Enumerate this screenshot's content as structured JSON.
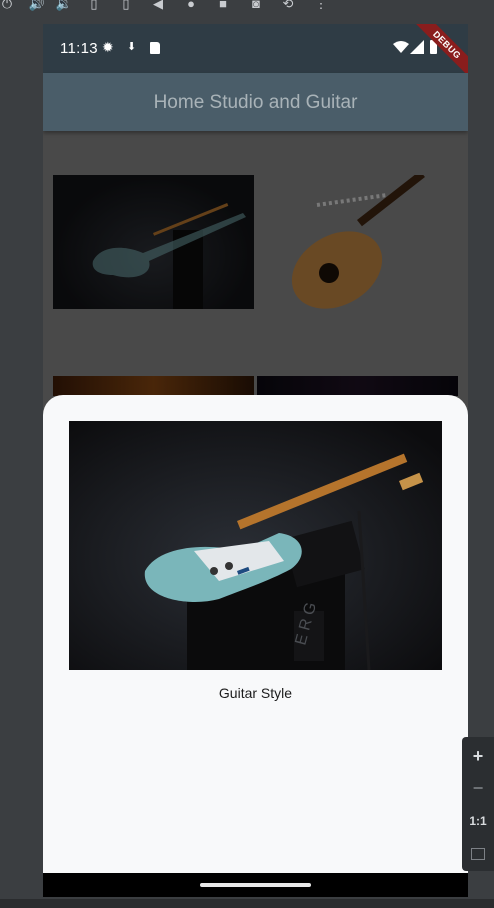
{
  "emulator_toolbar": {
    "icons": [
      "power-icon",
      "volume-up-icon",
      "volume-down-icon",
      "rotate-left-icon",
      "rotate-right-icon",
      "back-icon",
      "home-icon",
      "overview-icon",
      "screenshot-icon",
      "replay-icon",
      "more-icon"
    ]
  },
  "status_bar": {
    "time": "11:13",
    "left_icons": [
      "settings-icon",
      "location-icon",
      "sd-card-icon"
    ],
    "right_icons": [
      "wifi-icon",
      "cell-signal-icon",
      "battery-icon"
    ],
    "debug_banner": "DEBUG"
  },
  "app_bar": {
    "title": "Home Studio and Guitar"
  },
  "grid": {
    "images": [
      "electric-guitar-image",
      "acoustic-guitar-image",
      "studio-lights-image",
      "dark-stage-image"
    ]
  },
  "bottom_sheet": {
    "image": "electric-guitar-image",
    "caption": "Guitar Style"
  },
  "zoom_controls": {
    "zoom_in": "+",
    "zoom_out": "−",
    "actual_size": "1:1"
  },
  "colors": {
    "status_bar": "#2f3c45",
    "app_bar": "#4a5d69",
    "scrim": "#7a7a7a",
    "sheet": "#f8f9fa",
    "debug": "#8a1d1d"
  }
}
